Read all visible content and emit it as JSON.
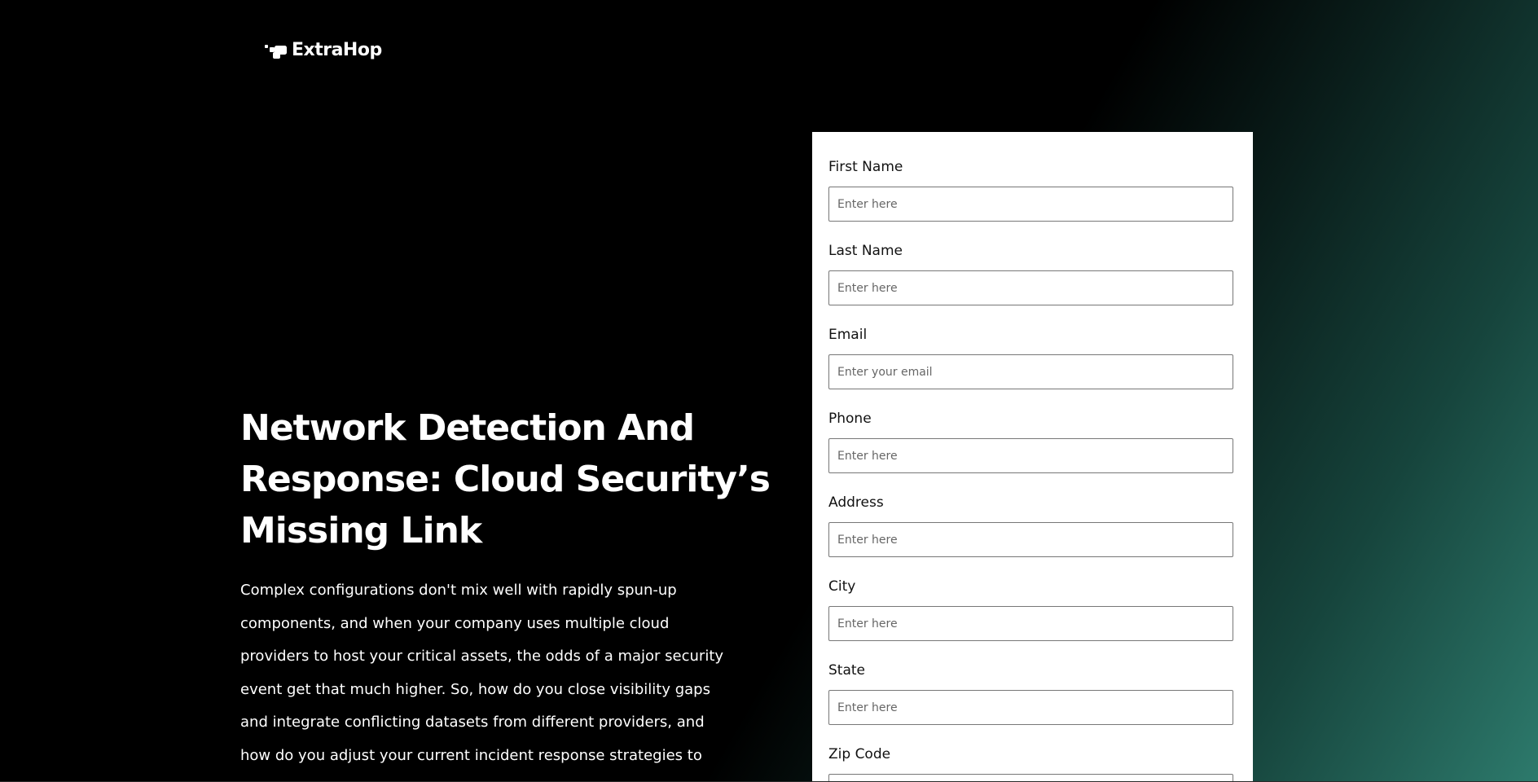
{
  "brand": {
    "name": "ExtraHop"
  },
  "hero": {
    "title": "Network Detection And Response: Cloud Security’s Missing Link",
    "body": "Complex configurations don't mix well with rapidly spun-up components, and when your company uses multiple cloud providers to host your critical assets, the odds of a major security event get that much higher. So, how do you close visibility gaps and integrate conflicting datasets from different providers, and how do you adjust your current incident response strategies to respond to"
  },
  "form": {
    "fields": [
      {
        "label": "First Name",
        "placeholder": "Enter here"
      },
      {
        "label": "Last Name",
        "placeholder": "Enter here"
      },
      {
        "label": "Email",
        "placeholder": "Enter your email"
      },
      {
        "label": "Phone",
        "placeholder": "Enter here"
      },
      {
        "label": "Address",
        "placeholder": "Enter here"
      },
      {
        "label": "City",
        "placeholder": "Enter here"
      },
      {
        "label": "State",
        "placeholder": "Enter here"
      },
      {
        "label": "Zip Code",
        "placeholder": ""
      }
    ]
  },
  "colors": {
    "background": "#000000",
    "gradient_accent": "#2d7a6c",
    "card": "#ffffff",
    "text_light": "#ffffff",
    "text_dark": "#111111"
  },
  "icons": {
    "logo": "extrahop-logo-icon"
  }
}
